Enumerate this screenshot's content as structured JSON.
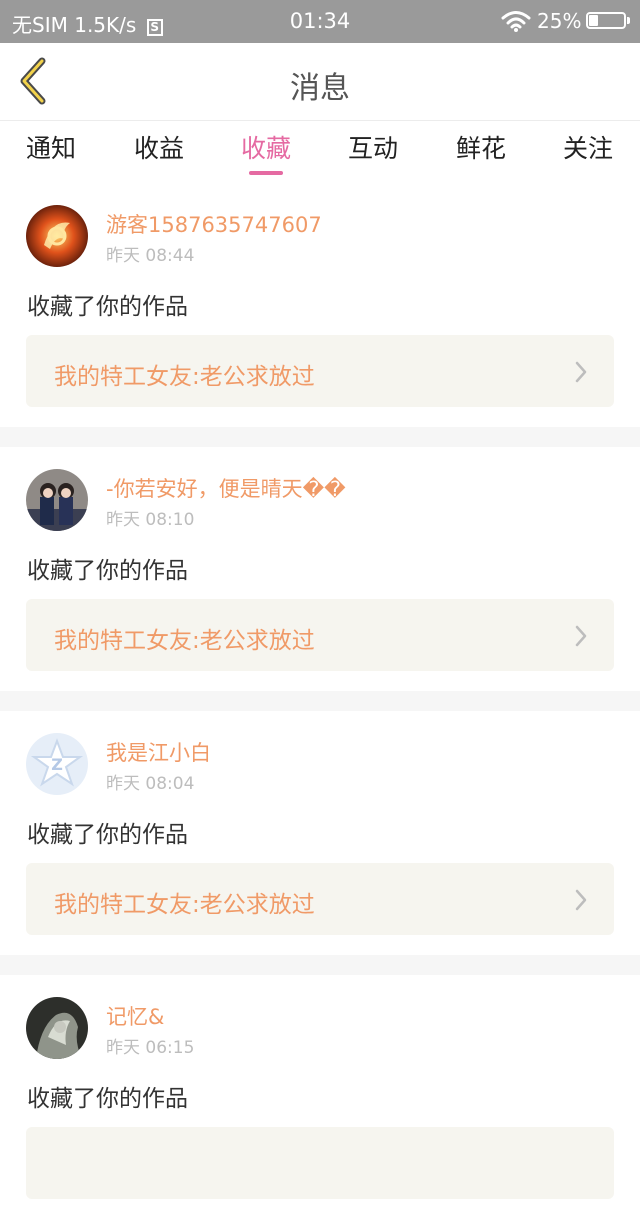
{
  "status_bar": {
    "carrier": "无SIM",
    "speed": "1.5K/s",
    "sim_badge": "S",
    "time": "01:34",
    "battery": "25%"
  },
  "header": {
    "title": "消息"
  },
  "tabs": [
    {
      "label": "通知",
      "active": false
    },
    {
      "label": "收益",
      "active": false
    },
    {
      "label": "收藏",
      "active": true
    },
    {
      "label": "互动",
      "active": false
    },
    {
      "label": "鲜花",
      "active": false
    },
    {
      "label": "关注",
      "active": false
    }
  ],
  "feed": [
    {
      "user": "游客1587635747607",
      "time": "昨天 08:44",
      "action": "收藏了你的作品",
      "work": "我的特工女友:老公求放过"
    },
    {
      "user": "-你若安好，便是晴天��",
      "time": "昨天 08:10",
      "action": "收藏了你的作品",
      "work": "我的特工女友:老公求放过"
    },
    {
      "user": "我是江小白",
      "time": "昨天 08:04",
      "action": "收藏了你的作品",
      "work": "我的特工女友:老公求放过"
    },
    {
      "user": "记忆&",
      "time": "昨天 06:15",
      "action": "收藏了你的作品",
      "work": ""
    }
  ],
  "colors": {
    "accent": "#e56aa2",
    "username": "#f09a67",
    "work_bg": "#f6f5ef",
    "status_bar": "#9a9a9a"
  }
}
